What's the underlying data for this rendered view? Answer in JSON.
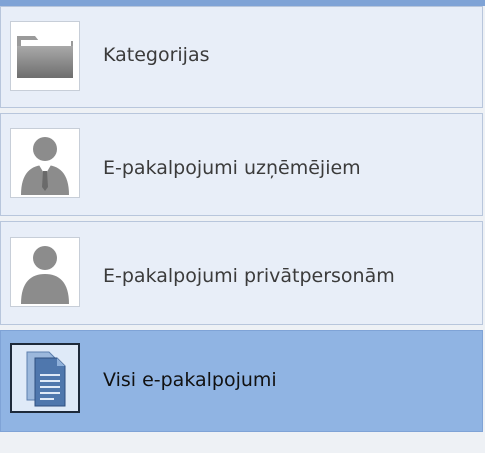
{
  "menu": {
    "items": [
      {
        "label": "Kategorijas",
        "icon": "folder-icon",
        "selected": false
      },
      {
        "label": "E-pakalpojumi uzņēmējiem",
        "icon": "business-person-icon",
        "selected": false
      },
      {
        "label": "E-pakalpojumi privātpersonām",
        "icon": "person-icon",
        "selected": false
      },
      {
        "label": "Visi e-pakalpojumi",
        "icon": "documents-icon",
        "selected": true
      }
    ]
  },
  "colors": {
    "accent": "#7fa3d6",
    "selected_bg": "#90b4e3",
    "item_bg": "#e8eef8",
    "page_bg": "#eef1f5"
  }
}
